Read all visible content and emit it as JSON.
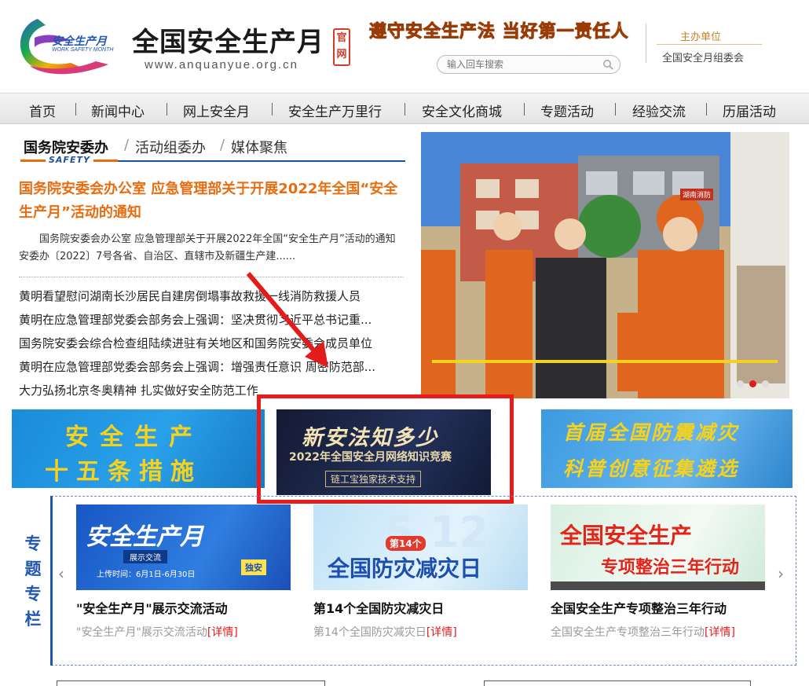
{
  "header": {
    "logo_cn": "安全生产月",
    "logo_en": "WORK SAFETY MONTH",
    "site_title": "全国安全生产月",
    "site_url": "www.anquanyue.org.cn",
    "official_seal": "官网",
    "slogan": "遵守安全生产法 当好第一责任人",
    "search_placeholder": "输入回车搜索",
    "organizer_label": "主办单位",
    "organizer_name": "全国安全月组委会"
  },
  "nav": {
    "items": [
      "首页",
      "新闻中心",
      "网上安全月",
      "安全生产万里行",
      "安全文化商城",
      "专题活动",
      "经验交流",
      "历届活动"
    ]
  },
  "news": {
    "tabs": [
      "国务院安委办",
      "活动组委办",
      "媒体聚焦"
    ],
    "tab_badge": "SAFETY",
    "headline": "国务院安委会办公室 应急管理部关于开展2022年全国“安全生产月”活动的通知",
    "summary": "国务院安委会办公室 应急管理部关于开展2022年全国“安全生产月”活动的通知安委办〔2022〕7号各省、自治区、直辖市及新疆生产建......",
    "items": [
      "黄明看望慰问湖南长沙居民自建房倒塌事故救援一线消防救援人员",
      "黄明在应急管理部党委会部务会上强调：坚决贯彻习近平总书记重...",
      "国务院安委会综合检查组陆续进驻有关地区和国务院安委会成员单位",
      "黄明在应急管理部党委会部务会上强调：增强责任意识 周密防范部...",
      "大力弘扬北京冬奥精神 扎实做好安全防范工作"
    ]
  },
  "slider": {
    "active_index": 1,
    "count": 3,
    "badge": "湖南消防"
  },
  "banners": {
    "left": {
      "line1": "安全生产",
      "line2": "十五条措施"
    },
    "mid": {
      "line1": "新安法知多少",
      "line2": "2022年全国安全月网络知识竞赛",
      "line3": "链工宝独家技术支持"
    },
    "right": {
      "line1": "首届全国防震减灾",
      "line2": "科普创意征集遴选"
    }
  },
  "special": {
    "title": "专题专栏",
    "prev_arrow": "‹",
    "next_arrow": "›",
    "cards": [
      {
        "img_title": "安全生产月",
        "img_sub": "展示交流",
        "img_time": "上传时间：6月1日-6月30日",
        "img_badge": "独安",
        "title": "\"安全生产月\"展示交流活动",
        "desc": "\"安全生产月\"展示交流活动",
        "link": "[详情]"
      },
      {
        "img_num": "第14个",
        "img_title": "全国防灾减灾日",
        "img_bg": "5.12",
        "title": "第14个全国防灾减灾日",
        "desc": "第14个全国防灾减灾日",
        "link": "[详情]"
      },
      {
        "img_title": "全国安全生产",
        "img_sub": "专项整治三年行动",
        "title": "全国安全生产专项整治三年行动",
        "desc": "全国安全生产专项整治三年行动",
        "link": "[详情]"
      }
    ]
  },
  "colors": {
    "accent_orange": "#ea6c10",
    "brand_blue": "#1d4fa0",
    "highlight_red": "#ea1b1b"
  }
}
